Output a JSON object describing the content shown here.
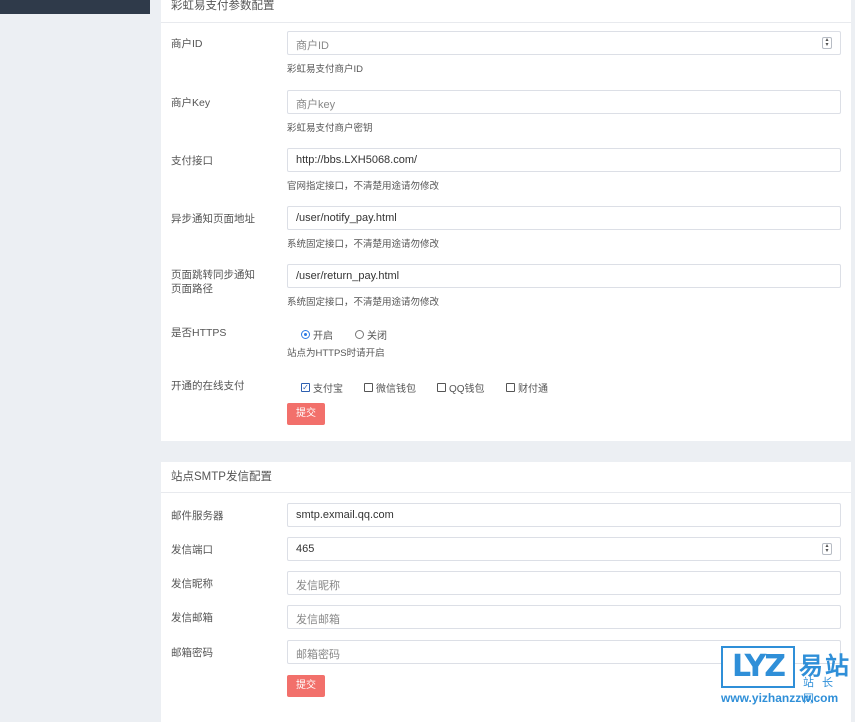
{
  "pay_panel": {
    "title": "彩虹易支付参数配置",
    "merchant_id": {
      "label": "商户ID",
      "placeholder": "商户ID",
      "value": "",
      "hint": "彩虹易支付商户ID"
    },
    "merchant_key": {
      "label": "商户Key",
      "placeholder": "商户key",
      "value": "",
      "hint": "彩虹易支付商户密钥"
    },
    "pay_api": {
      "label": "支付接口",
      "value": "http://bbs.LXH5068.com/",
      "hint": "官网指定接口，不清楚用途请勿修改"
    },
    "notify_url": {
      "label": "异步通知页面地址",
      "value": "/user/notify_pay.html",
      "hint": "系统固定接口，不清楚用途请勿修改"
    },
    "return_url": {
      "label": "页面跳转同步通知页面路径",
      "value": "/user/return_pay.html",
      "hint": "系统固定接口，不清楚用途请勿修改"
    },
    "https": {
      "label": "是否HTTPS",
      "on_label": "开启",
      "off_label": "关闭",
      "selected": "开启",
      "hint": "站点为HTTPS时请开启"
    },
    "online_pay": {
      "label": "开通的在线支付",
      "options": [
        {
          "label": "支付宝",
          "checked": true
        },
        {
          "label": "微信钱包",
          "checked": false
        },
        {
          "label": "QQ钱包",
          "checked": false
        },
        {
          "label": "财付通",
          "checked": false
        }
      ]
    },
    "submit_label": "提交"
  },
  "smtp_panel": {
    "title": "站点SMTP发信配置",
    "server": {
      "label": "邮件服务器",
      "value": "smtp.exmail.qq.com"
    },
    "port": {
      "label": "发信端口",
      "value": "465"
    },
    "nickname": {
      "label": "发信昵称",
      "placeholder": "发信昵称",
      "value": ""
    },
    "email": {
      "label": "发信邮箱",
      "placeholder": "发信邮箱",
      "value": ""
    },
    "password": {
      "label": "邮箱密码",
      "placeholder": "邮箱密码",
      "value": ""
    },
    "submit_label": "提交"
  },
  "watermark": {
    "logo_letters": "LYZ",
    "cn_title": "易站",
    "cn_sub": "站长网",
    "url": "www.yizhanzzw.com"
  },
  "colors": {
    "accent_button": "#f2706b",
    "checkbox_check": "#2d5fb0",
    "radio_on": "#2d7be5",
    "watermark_blue": "#2f8fd8"
  }
}
